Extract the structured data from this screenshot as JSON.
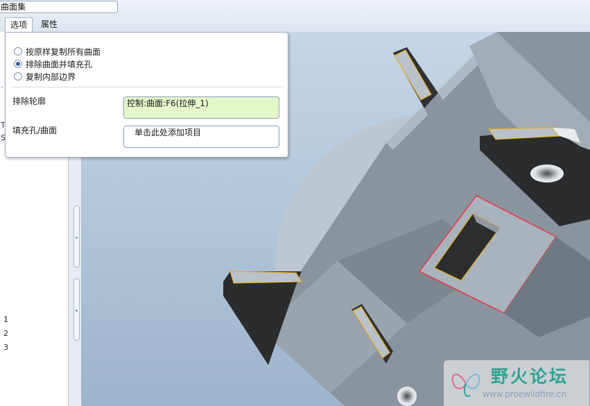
{
  "window": {
    "title_field_value": "曲面集"
  },
  "tabs": [
    {
      "label": "选项",
      "active": true
    },
    {
      "label": "属性",
      "active": false
    }
  ],
  "options": {
    "radios": [
      {
        "label": "按原样复制所有曲面",
        "checked": false
      },
      {
        "label": "排除曲面并填充孔",
        "checked": true
      },
      {
        "label": "复制内部边界",
        "checked": false
      }
    ],
    "exclude_label": "排除轮廓",
    "exclude_value": "控制:曲面:F6(拉伸_1)",
    "fill_label": "填充孔/曲面",
    "fill_value": "单击此处添加项目"
  },
  "model_tree": {
    "fragments": [
      ".",
      "T",
      "S"
    ],
    "numbers": [
      "1",
      "2",
      "3"
    ]
  },
  "watermark": {
    "title": "野火论坛",
    "url": "www.proewildfire.cn"
  },
  "colors": {
    "accent_selected_field": "#e4f7c9",
    "highlight_edge": "#e8364a",
    "selected_surface_edge": "#f2a800",
    "watermark_text": "#2fa48f"
  },
  "icons": {
    "watermark_logo": "butterfly-flame-logo-icon"
  }
}
